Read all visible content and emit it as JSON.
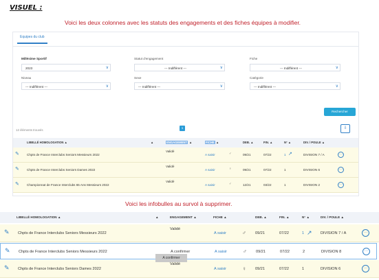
{
  "heading": "VISUEL :",
  "captions": {
    "top": "Voici les deux colonnes avec les statuts des engagements et des fiches équipes à modifier.",
    "bottom": "Voici les infobulles au survol à supprimer."
  },
  "tab": "Equipes du club",
  "filters": {
    "millesime": {
      "label": "Millésime Sportif",
      "value": "2023"
    },
    "statut": {
      "label": "Statut d'engagement",
      "value": "--- Indifférent ---"
    },
    "fiche": {
      "label": "Fiche",
      "value": "--- Indifférent ---"
    },
    "niveau": {
      "label": "Niveau",
      "value": "--- Indifférent ---"
    },
    "sexe": {
      "label": "Sexe",
      "value": "--- Indifférent ---"
    },
    "categorie": {
      "label": "Catégorie",
      "value": "--- Indifférent ---"
    }
  },
  "search_label": "Rechercher",
  "count_label": "12 éléments trouvés",
  "page": "1",
  "columns": {
    "libelle": "LIBELLÉ HOMOLOGATION",
    "engagement": "ENGAGEMENT",
    "fiche": "FICHE",
    "deb": "DEB.",
    "fin": "FIN.",
    "n": "N°",
    "div": "DIV. / POULE"
  },
  "sort_glyph": "▲",
  "table1": [
    {
      "libelle": "Chpts de France Interclubs Seniors Messieurs 2022",
      "engagement": "Validé",
      "fiche": "A saisir",
      "gender": "♂",
      "deb": "09/21",
      "fin": "07/22",
      "n": "1",
      "div": "DIVISION 7 / A"
    },
    {
      "libelle": "Chpts de France Interclubs Seniors Dames 2022",
      "engagement": "Validé",
      "fiche": "A saisir",
      "gender": "♀",
      "deb": "09/21",
      "fin": "07/22",
      "n": "1",
      "div": "DIVISION 6"
    },
    {
      "libelle": "Championnat de France Interclubs 65 Ans Messieurs 2022",
      "engagement": "Validé",
      "fiche": "A saisir",
      "gender": "♂",
      "deb": "12/21",
      "fin": "03/22",
      "n": "1",
      "div": "DIVISION 2"
    }
  ],
  "table2": [
    {
      "libelle": "Chpts de France Interclubs Seniors Messieurs 2022",
      "engagement": "Validé",
      "fiche": "A saisir",
      "gender": "♂",
      "deb": "09/21",
      "fin": "07/22",
      "n": "1",
      "div": "DIVISION 7 / A"
    },
    {
      "libelle": "Chpts de France Interclubs Seniors Messieurs 2022",
      "engagement": "A confirmer",
      "fiche": "A saisir",
      "gender": "♂",
      "deb": "09/21",
      "fin": "07/22",
      "n": "2",
      "div": "DIVISION 8"
    },
    {
      "libelle": "Chpts de France Interclubs Seniors Dames 2022",
      "engagement": "Validé",
      "fiche": "A saisir",
      "gender": "♀",
      "deb": "09/21",
      "fin": "07/22",
      "n": "1",
      "div": "DIVISION 6"
    }
  ],
  "tooltip": "A confirmer",
  "icons": {
    "edit": "pencil-icon",
    "more": "more-options-icon",
    "external": "external-link-icon",
    "export": "export-icon"
  },
  "colors": {
    "accent": "#2f7fc6",
    "button": "#27a6d6",
    "row": "#fdfbe6",
    "caption": "#c0202a"
  }
}
